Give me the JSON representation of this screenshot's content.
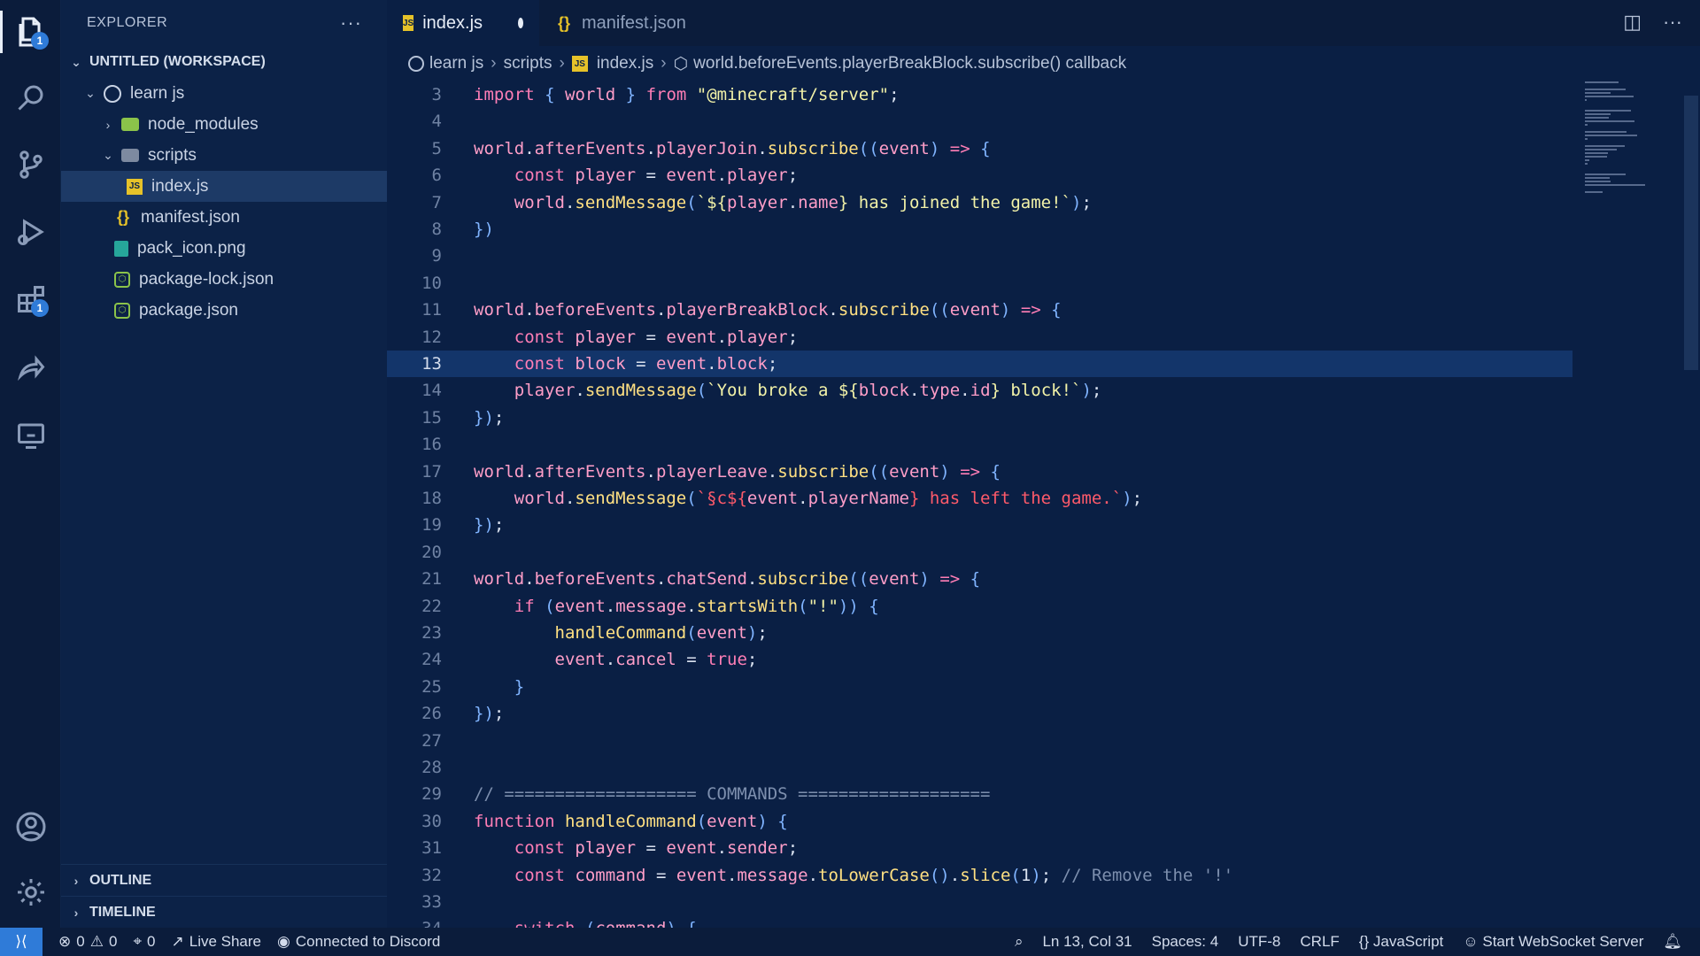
{
  "sidebar": {
    "title": "EXPLORER",
    "workspace": "UNTITLED (WORKSPACE)",
    "tree": [
      {
        "label": "learn js",
        "kind": "root"
      },
      {
        "label": "node_modules",
        "kind": "folder"
      },
      {
        "label": "scripts",
        "kind": "folder-open"
      },
      {
        "label": "index.js",
        "kind": "js"
      },
      {
        "label": "manifest.json",
        "kind": "json"
      },
      {
        "label": "pack_icon.png",
        "kind": "png"
      },
      {
        "label": "package-lock.json",
        "kind": "npm"
      },
      {
        "label": "package.json",
        "kind": "npm"
      }
    ],
    "sections": [
      "OUTLINE",
      "TIMELINE"
    ]
  },
  "activity": {
    "explorer_badge": "1",
    "extensions_badge": "1"
  },
  "tabs": [
    {
      "label": "index.js",
      "icon": "JS",
      "active": true,
      "dirty": true
    },
    {
      "label": "manifest.json",
      "icon": "{}",
      "active": false
    }
  ],
  "breadcrumbs": [
    "learn js",
    "scripts",
    "index.js",
    "world.beforeEvents.playerBreakBlock.subscribe() callback"
  ],
  "editor": {
    "current_line": 13,
    "lines": [
      {
        "n": "3",
        "html": "<span class='kw'>import</span> <span class='pn'>{</span> <span class='vr'>world</span> <span class='pn'>}</span> <span class='kw'>from</span> <span class='st'>\"@minecraft/server\"</span>;"
      },
      {
        "n": "4",
        "html": ""
      },
      {
        "n": "5",
        "html": "<span class='vr'>world</span>.<span class='vr'>afterEvents</span>.<span class='vr'>playerJoin</span>.<span class='fn'>subscribe</span><span class='pn'>((</span><span class='vr'>event</span><span class='pn'>)</span> <span class='kw'>=></span> <span class='pn'>{</span>"
      },
      {
        "n": "6",
        "html": "    <span class='kw'>const</span> <span class='vr'>player</span> = <span class='vr'>event</span>.<span class='vr'>player</span>;"
      },
      {
        "n": "7",
        "html": "    <span class='vr'>world</span>.<span class='fn'>sendMessage</span><span class='pn'>(</span><span class='st'>`${</span><span class='vr'>player</span>.<span class='vr'>name</span><span class='st'>} has joined the game!`</span><span class='pn'>)</span>;"
      },
      {
        "n": "8",
        "html": "<span class='pn'>})</span>"
      },
      {
        "n": "9",
        "html": ""
      },
      {
        "n": "10",
        "html": ""
      },
      {
        "n": "11",
        "html": "<span class='vr'>world</span>.<span class='vr'>beforeEvents</span>.<span class='vr'>playerBreakBlock</span>.<span class='fn'>subscribe</span><span class='pn'>((</span><span class='vr'>event</span><span class='pn'>)</span> <span class='kw'>=></span> <span class='pn'>{</span>"
      },
      {
        "n": "12",
        "html": "    <span class='kw'>const</span> <span class='vr'>player</span> = <span class='vr'>event</span>.<span class='vr'>player</span>;"
      },
      {
        "n": "13",
        "html": "    <span class='kw'>const</span> <span class='vr'>block</span> = <span class='vr'>event</span>.<span class='vr'>block</span>;"
      },
      {
        "n": "14",
        "html": "    <span class='vr'>player</span>.<span class='fn'>sendMessage</span><span class='pn'>(</span><span class='st'>`You broke a ${</span><span class='vr'>block</span>.<span class='vr'>type</span>.<span class='vr'>id</span><span class='st'>} block!`</span><span class='pn'>)</span>;"
      },
      {
        "n": "15",
        "html": "<span class='pn'>})</span>;"
      },
      {
        "n": "16",
        "html": ""
      },
      {
        "n": "17",
        "html": "<span class='vr'>world</span>.<span class='vr'>afterEvents</span>.<span class='vr'>playerLeave</span>.<span class='fn'>subscribe</span><span class='pn'>((</span><span class='vr'>event</span><span class='pn'>)</span> <span class='kw'>=></span> <span class='pn'>{</span>"
      },
      {
        "n": "18",
        "html": "    <span class='vr'>world</span>.<span class='fn'>sendMessage</span><span class='pn'>(</span><span class='st2'>`§c${</span><span class='vr'>event</span>.<span class='vr'>playerName</span><span class='st2'>} has left the game.`</span><span class='pn'>)</span>;"
      },
      {
        "n": "19",
        "html": "<span class='pn'>})</span>;"
      },
      {
        "n": "20",
        "html": ""
      },
      {
        "n": "21",
        "html": "<span class='vr'>world</span>.<span class='vr'>beforeEvents</span>.<span class='vr'>chatSend</span>.<span class='fn'>subscribe</span><span class='pn'>((</span><span class='vr'>event</span><span class='pn'>)</span> <span class='kw'>=></span> <span class='pn'>{</span>"
      },
      {
        "n": "22",
        "html": "    <span class='kw'>if</span> <span class='pn'>(</span><span class='vr'>event</span>.<span class='vr'>message</span>.<span class='fn'>startsWith</span><span class='pn'>(</span><span class='st'>\"!\"</span><span class='pn'>))</span> <span class='pn'>{</span>"
      },
      {
        "n": "23",
        "html": "        <span class='fn'>handleCommand</span><span class='pn'>(</span><span class='vr'>event</span><span class='pn'>)</span>;"
      },
      {
        "n": "24",
        "html": "        <span class='vr'>event</span>.<span class='vr'>cancel</span> = <span class='kw'>true</span>;"
      },
      {
        "n": "25",
        "html": "    <span class='pn'>}</span>"
      },
      {
        "n": "26",
        "html": "<span class='pn'>})</span>;"
      },
      {
        "n": "27",
        "html": ""
      },
      {
        "n": "28",
        "html": ""
      },
      {
        "n": "29",
        "html": "<span class='cm'>// =================== COMMANDS ===================</span>"
      },
      {
        "n": "30",
        "html": "<span class='kw'>function</span> <span class='fn'>handleCommand</span><span class='pn'>(</span><span class='vr'>event</span><span class='pn'>)</span> <span class='pn'>{</span>"
      },
      {
        "n": "31",
        "html": "    <span class='kw'>const</span> <span class='vr'>player</span> = <span class='vr'>event</span>.<span class='vr'>sender</span>;"
      },
      {
        "n": "32",
        "html": "    <span class='kw'>const</span> <span class='vr'>command</span> = <span class='vr'>event</span>.<span class='vr'>message</span>.<span class='fn'>toLowerCase</span><span class='pn'>()</span>.<span class='fn'>slice</span><span class='pn'>(</span>1<span class='pn'>)</span>; <span class='cm'>// Remove the '!'</span>"
      },
      {
        "n": "33",
        "html": ""
      },
      {
        "n": "34",
        "html": "    <span class='kw'>switch</span> <span class='pn'>(</span><span class='vr'>command</span><span class='pn'>)</span> <span class='pn'>{</span>"
      }
    ]
  },
  "status": {
    "errors": "0",
    "warnings": "0",
    "ports": "0",
    "live_share": "Live Share",
    "discord": "Connected to Discord",
    "position": "Ln 13, Col 31",
    "spaces": "Spaces: 4",
    "encoding": "UTF-8",
    "eol": "CRLF",
    "language": "JavaScript",
    "websocket": "Start WebSocket Server"
  },
  "colors": {
    "background": "#0a1f44",
    "accent": "#2f7bd8"
  }
}
